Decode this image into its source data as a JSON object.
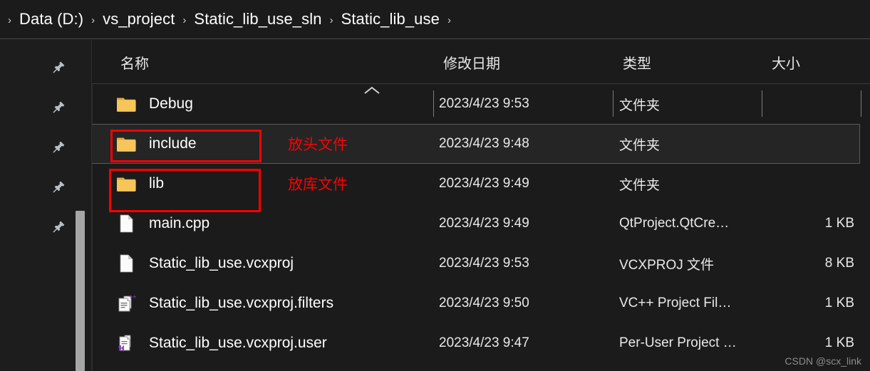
{
  "breadcrumb": {
    "leading_separator": "›",
    "separator": "›",
    "items": [
      "Data (D:)",
      "vs_project",
      "Static_lib_use_sln",
      "Static_lib_use"
    ]
  },
  "sidebar": {
    "pin_items": [
      {
        "icon": "pin-icon"
      },
      {
        "icon": "pin-icon"
      },
      {
        "icon": "pin-icon"
      },
      {
        "icon": "pin-icon"
      },
      {
        "icon": "pin-icon"
      }
    ],
    "scrollbar": {
      "name": "vertical-scrollbar-thumb"
    }
  },
  "columns": {
    "name": "名称",
    "date_modified": "修改日期",
    "type": "类型",
    "size": "大小",
    "sort_indicator": "chevron-up-icon"
  },
  "rows": [
    {
      "name": "Debug",
      "icon": "folder-icon",
      "note": "",
      "date": "2023/4/23 9:53",
      "type": "文件夹",
      "size": "",
      "highlighted": false,
      "boxed": false
    },
    {
      "name": "include",
      "icon": "folder-icon",
      "note": "放头文件",
      "date": "2023/4/23 9:48",
      "type": "文件夹",
      "size": "",
      "highlighted": true,
      "boxed": true
    },
    {
      "name": "lib",
      "icon": "folder-icon",
      "note": "放库文件",
      "date": "2023/4/23 9:49",
      "type": "文件夹",
      "size": "",
      "highlighted": false,
      "boxed": true
    },
    {
      "name": "main.cpp",
      "icon": "file-blank-icon",
      "note": "",
      "date": "2023/4/23 9:49",
      "type": "QtProject.QtCre…",
      "size": "1 KB",
      "highlighted": false,
      "boxed": false
    },
    {
      "name": "Static_lib_use.vcxproj",
      "icon": "file-blank-icon",
      "note": "",
      "date": "2023/4/23 9:53",
      "type": "VCXPROJ 文件",
      "size": "8 KB",
      "highlighted": false,
      "boxed": false
    },
    {
      "name": "Static_lib_use.vcxproj.filters",
      "icon": "vc-filters-icon",
      "note": "",
      "date": "2023/4/23 9:50",
      "type": "VC++ Project Fil…",
      "size": "1 KB",
      "highlighted": false,
      "boxed": false
    },
    {
      "name": "Static_lib_use.vcxproj.user",
      "icon": "vs-user-file-icon",
      "note": "",
      "date": "2023/4/23 9:47",
      "type": "Per-User Project …",
      "size": "1 KB",
      "highlighted": false,
      "boxed": false
    }
  ],
  "watermark": "CSDN @scx_link",
  "colors": {
    "background": "#1b1b1b",
    "annotation_red": "#fd0000",
    "folder_amber": "#f7c65a",
    "text_primary": "#ffffff",
    "vs_purple": "#8e44c6"
  }
}
